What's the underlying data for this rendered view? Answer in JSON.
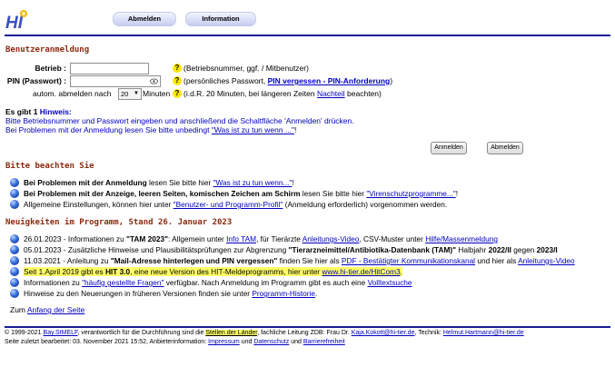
{
  "header": {
    "logo_text": "HI",
    "nav": [
      {
        "label": "Abmelden"
      },
      {
        "label": "Information"
      }
    ]
  },
  "login": {
    "section_title": "Benutzeranmeldung",
    "betrieb_label": "Betrieb :",
    "betrieb_value": "",
    "betrieb_help": "(Betriebsnummer, ggf. / Mitbenutzer)",
    "pin_label": "PIN (Passwort) :",
    "pin_value": "",
    "pin_help_prefix": "(persönliches Passwort, ",
    "pin_help_link": "PIN vergessen - PIN-Anforderung",
    "pin_help_suffix": ")",
    "logout_label": "autom. abmelden nach",
    "logout_value": "20",
    "logout_unit": "Minuten",
    "logout_help_prefix": "(i.d.R. 20 Minuten, bei längeren Zeiten ",
    "logout_help_link": "Nachteil",
    "logout_help_suffix": " beachten)",
    "help_mark": "?"
  },
  "hint": {
    "title_prefix": "Es gibt 1 ",
    "title_word": "Hinweis:",
    "line1": "Bitte Betriebsnummer und Passwort eingeben und anschließend die Schaltfläche 'Anmelden' drücken.",
    "line2_prefix": "Bei Problemen mit der Anmeldung lesen Sie bitte unbedingt ",
    "line2_link": "\"Was ist zu tun wenn ...\"",
    "line2_suffix": "!"
  },
  "buttons": {
    "anmelden1": "Anmelden",
    "anmelden2": "Abmelden"
  },
  "notes": {
    "section_title": "Bitte beachten Sie",
    "items": [
      {
        "bold": "Bei Problemen mit der Anmeldung",
        "text": " lesen Sie bitte hier ",
        "link": "\"Was ist zu tun wenn...\"",
        "suffix": "!"
      },
      {
        "bold": "Bei Problemen mit der Anzeige, leeren Seiten, komischen Zeichen am Schirm",
        "text": " lesen Sie bitte hier ",
        "link": "\"Virenschutzprogramme...\"",
        "suffix": "!"
      },
      {
        "bold": "",
        "text": "Allgemeine Einstellungen, können hier unter ",
        "link": "\"Benutzer- und Programm-Profil\"",
        "suffix": " (Anmeldung erforderlich) vorgenommen werden."
      }
    ]
  },
  "news": {
    "section_title": "Neuigkeiten im Programm, Stand 26. Januar 2023",
    "items": [
      {
        "t1": "26.01.2023 - Informationen zu ",
        "b1": "\"TAM 2023\"",
        "t2": ": Allgemein unter ",
        "l1": "Info TAM",
        "t3": ", für Tierärzte ",
        "l2": "Anleitungs-Video",
        "t4": ", CSV-Muster unter ",
        "l3": "Hilfe/Massenmeldung",
        "t5": ""
      },
      {
        "t1": "05.01.2023 - Zusätzliche Hinweise und Plausibilitätsprüfungen zur Abgrenzung ",
        "b1": "\"Tierarzneimittel/Antibiotika-Datenbank (TAM)\"",
        "t2": " Halbjahr ",
        "b2": "2022/II",
        "t3": " gegen ",
        "b3": "2023/I"
      },
      {
        "t1": "11.03.2021 - Anleitung zu ",
        "b1": "\"Mail-Adresse hinterlegen und PIN vergessen\"",
        "t2": " finden Sie hier als ",
        "l1": "PDF - Bestätigter Kommunikationskanal",
        "t3": " und hier als ",
        "l2": "Anleitungs-Video"
      },
      {
        "t1": "Seit 1.April 2019 gibt es ",
        "b1": "HIT 3.0",
        "t2": ", eine neue Version des HIT-Meldeprogramms, hier unter ",
        "l1": "www.hi-tier.de/HitCom3",
        "t3": "."
      },
      {
        "t1": "Informationen zu ",
        "l1": "\"häufig gestellte Fragen\"",
        "t2": " verfügbar. Nach Anmeldung im Programm gibt es auch eine ",
        "l2": "Volltextsuche"
      },
      {
        "t1": "Hinweise zu den Neuerungen in früheren Versionen finden sie unter ",
        "l1": "Programm-Historie",
        "t2": "."
      }
    ],
    "top_prefix": "Zum ",
    "top_link": "Anfang der Seite"
  },
  "footer": {
    "line1_a": "© 1999-2021 ",
    "line1_link1": "Bay.StMELF",
    "line1_b": ", verantwortlich für die Durchführung sind die ",
    "line1_link2": "Stellen der Länder",
    "line1_c": ", fachliche Leitung ZDB: Frau Dr. ",
    "line1_link3": "Kaja.Kokott@hi-tier.de",
    "line1_d": ", Technik: ",
    "line1_link4": "Helmut.Hartmann@hi-tier.de",
    "line2_a": "Seite zuletzt bearbeitet: 03. November 2021 15:52, Anbieterinformation: ",
    "line2_link1": "Impressum",
    "line2_b": " und ",
    "line2_link2": "Datenschutz",
    "line2_c": " und ",
    "line2_link3": "Barrierefreiheit"
  }
}
